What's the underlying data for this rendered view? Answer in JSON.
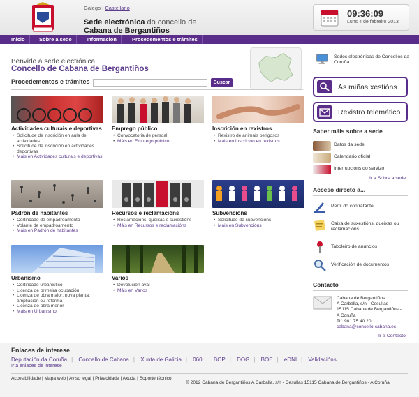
{
  "header": {
    "lang_current": "Galego",
    "lang_other": "Castellano",
    "title_bold_1": "Sede electrónica",
    "title_light_1": "do concello de",
    "title_line_2": "Cabana de Bergantiños",
    "time": "09:36:09",
    "date": "Luns 4 de febreiro 2013"
  },
  "nav": [
    "Inicio",
    "Sobre a sede",
    "Información",
    "Procedementos e trámites"
  ],
  "welcome": {
    "line1": "Benvido á sede electrónica",
    "line2": "Concello de Cabana de Bergantiños"
  },
  "search": {
    "label": "Procedementos e trámites",
    "button": "Buscar",
    "placeholder": ""
  },
  "tiles": [
    {
      "title": "Actividades culturais e deportivas",
      "items": [
        "Solicitude de inscrición en aula de actividades",
        "Solicitude de inscrición en actividades deportivas"
      ],
      "more": "Máis en Actividades culturais e deportivas"
    },
    {
      "title": "Emprego público",
      "items": [
        "Convocatoria de persoal"
      ],
      "more": "Máis en Emprego público"
    },
    {
      "title": "Inscrición en rexistros",
      "items": [
        "Rexistro de animais perigosos"
      ],
      "more": "Máis en Inscrición en rexistros"
    },
    {
      "title": "Padrón de habitantes",
      "items": [
        "Certificado de empadroamento",
        "Volante de empadroamento"
      ],
      "more": "Máis en Padrón de habitantes"
    },
    {
      "title": "Recursos e reclamacións",
      "items": [
        "Reclamacións, queixas e suxestións"
      ],
      "more": "Máis en Recursos e reclamacións"
    },
    {
      "title": "Subvencións",
      "items": [
        "Solicitude de subvencións"
      ],
      "more": "Máis en Subvencións"
    },
    {
      "title": "Urbanismo",
      "items": [
        "Certificado urbanístico",
        "Licenza de primeira ocupación",
        "Licenza de obra maior: nova planta, ampliación ou reforma",
        "Licenza de obra menor"
      ],
      "more": "Máis en Urbanismo"
    },
    {
      "title": "Varios",
      "items": [
        "Devolución aval"
      ],
      "more": "Máis en Varios"
    }
  ],
  "sidebar": {
    "sedes_link": "Sedes electrónicas de Concellos da Coruña",
    "btn_xestions": "As miñas xestións",
    "btn_rexistro": "Rexistro telemático",
    "saber_title": "Saber máis sobre a sede",
    "saber_items": [
      "Datos da sede",
      "Calendario oficial",
      "Interrupcións do servizo"
    ],
    "saber_more": "Ir a Sobre a sede",
    "acceso_title": "Acceso directo a...",
    "acceso_items": [
      "Perfil do contratante",
      "Caixa de suxestións, queixas ou reclamacións",
      "Taboleiro de anuncios",
      "Verificación de documentos"
    ],
    "contacto_title": "Contacto",
    "contact_lines": [
      "Cabana de Bergantiños",
      "A Carballa, s/n - Cesullas",
      "15115 Cabana de Bergantiños -",
      "A Coruña",
      "Tlf: 981 75 40 20"
    ],
    "contact_email": "cabana@concello-cabana.es",
    "contact_more": "Ir a Contacto"
  },
  "footer": {
    "links_title": "Enlaces de interese",
    "links": [
      "Deputación da Coruña",
      "Concello de Cabana",
      "Xunta de Galicia",
      "060",
      "BOP",
      "DOG",
      "BOE",
      "eDNI",
      "Validacións"
    ],
    "links_more": "Ir a enlaces de interese",
    "bottom_links": [
      "Accesibilidade",
      "Mapa web",
      "Aviso legal",
      "Privacidade",
      "Axuda",
      "Soporte técnico"
    ],
    "copyright": "© 2012 Cabana de Bergantiños A Carballa, s/n - Cesullas 15115 Cabana de Bergantiños - A Coruña"
  },
  "colors": {
    "accent": "#5a2d8a",
    "link": "#5b3b8c"
  }
}
